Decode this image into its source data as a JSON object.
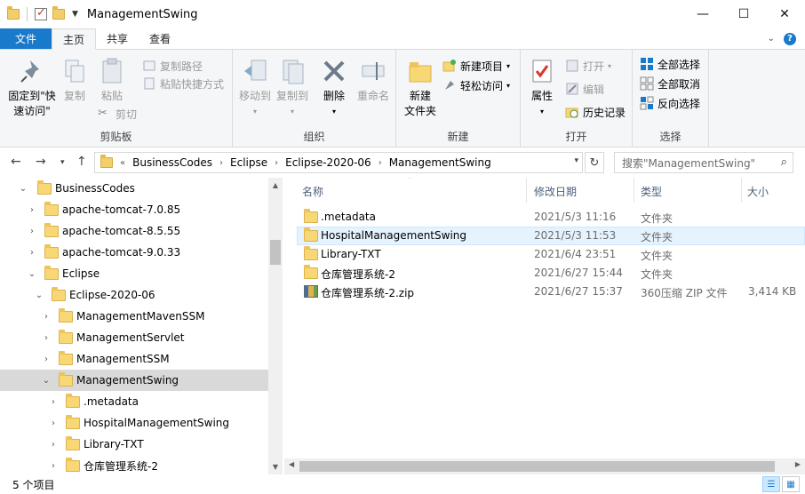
{
  "window": {
    "title": "ManagementSwing",
    "minimize": "—",
    "maximize": "☐",
    "close": "✕"
  },
  "ribbon_tabs": {
    "file": "文件",
    "home": "主页",
    "share": "共享",
    "view": "查看",
    "help": "?"
  },
  "clipboard": {
    "pin_quick_line1": "固定到\"快",
    "pin_quick_line2": "速访问\"",
    "copy": "复制",
    "paste": "粘贴",
    "copy_path": "复制路径",
    "paste_shortcut": "粘贴快捷方式",
    "cut": "剪切",
    "label": "剪贴板"
  },
  "organize": {
    "move_to": "移动到",
    "copy_to": "复制到",
    "delete": "删除",
    "rename": "重命名",
    "label": "组织"
  },
  "new_group": {
    "new_folder_line1": "新建",
    "new_folder_line2": "文件夹",
    "new_item": "新建项目",
    "easy_access": "轻松访问",
    "label": "新建"
  },
  "open_group": {
    "properties": "属性",
    "open": "打开",
    "edit": "编辑",
    "history": "历史记录",
    "label": "打开"
  },
  "select_group": {
    "select_all": "全部选择",
    "select_none": "全部取消",
    "invert": "反向选择",
    "label": "选择"
  },
  "address": {
    "overflow": "«",
    "crumbs": [
      "BusinessCodes",
      "Eclipse",
      "Eclipse-2020-06",
      "ManagementSwing"
    ],
    "search_placeholder": "搜索\"ManagementSwing\""
  },
  "tree": [
    {
      "label": "BusinessCodes"
    },
    {
      "label": "apache-tomcat-7.0.85"
    },
    {
      "label": "apache-tomcat-8.5.55"
    },
    {
      "label": "apache-tomcat-9.0.33"
    },
    {
      "label": "Eclipse"
    },
    {
      "label": "Eclipse-2020-06"
    },
    {
      "label": "ManagementMavenSSM"
    },
    {
      "label": "ManagementServlet"
    },
    {
      "label": "ManagementSSM"
    },
    {
      "label": "ManagementSwing"
    },
    {
      "label": ".metadata"
    },
    {
      "label": "HospitalManagementSwing"
    },
    {
      "label": "Library-TXT"
    },
    {
      "label": "仓库管理系统-2"
    }
  ],
  "columns": {
    "name": "名称",
    "modified": "修改日期",
    "type": "类型",
    "size": "大小"
  },
  "files": [
    {
      "name": ".metadata",
      "modified": "2021/5/3 11:16",
      "type": "文件夹",
      "size": ""
    },
    {
      "name": "HospitalManagementSwing",
      "modified": "2021/5/3 11:53",
      "type": "文件夹",
      "size": ""
    },
    {
      "name": "Library-TXT",
      "modified": "2021/6/4 23:51",
      "type": "文件夹",
      "size": ""
    },
    {
      "name": "仓库管理系统-2",
      "modified": "2021/6/27 15:44",
      "type": "文件夹",
      "size": ""
    },
    {
      "name": "仓库管理系统-2.zip",
      "modified": "2021/6/27 15:37",
      "type": "360压缩 ZIP 文件",
      "size": "3,414 KB"
    }
  ],
  "status": {
    "count": "5 个项目"
  },
  "colors": {
    "accent": "#1979ca",
    "folder": "#f8d775",
    "selection": "#d9d9d9",
    "hover": "#e5f3ff"
  }
}
